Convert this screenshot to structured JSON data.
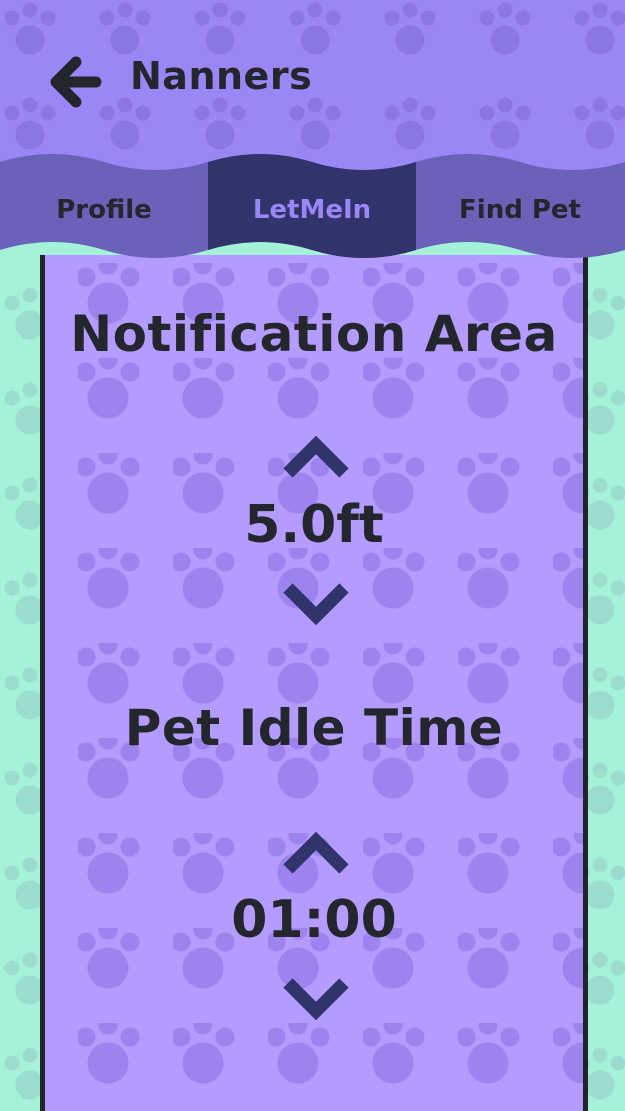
{
  "header": {
    "title": "Nanners",
    "back_icon": "arrow-left-icon"
  },
  "tabs": [
    {
      "label": "Profile",
      "active": false
    },
    {
      "label": "LetMeIn",
      "active": true
    },
    {
      "label": "Find Pet",
      "active": false
    }
  ],
  "notification_area": {
    "title": "Notification Area",
    "value": "5.0ft",
    "up_icon": "chevron-up-icon",
    "down_icon": "chevron-down-icon"
  },
  "pet_idle_time": {
    "title": "Pet Idle Time",
    "value": "01:00",
    "up_icon": "chevron-up-icon",
    "down_icon": "chevron-down-icon"
  },
  "colors": {
    "header": "#9b86f6",
    "tab_bar": "#6a62b8",
    "tab_active": "#30346a",
    "panel": "#b49bff",
    "side": "#a4f3d8",
    "text": "#24262d"
  }
}
